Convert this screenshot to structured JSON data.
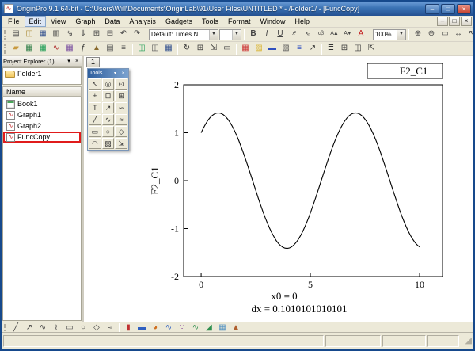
{
  "window": {
    "title": "OriginPro 9.1 64-bit - C:\\Users\\Will\\Documents\\OriginLab\\91\\User Files\\UNTITLED * - /Folder1/ - [FuncCopy]",
    "controls": {
      "minimize": "–",
      "maximize": "□",
      "close": "×"
    }
  },
  "menu": {
    "items": [
      "File",
      "Edit",
      "View",
      "Graph",
      "Data",
      "Analysis",
      "Gadgets",
      "Tools",
      "Format",
      "Window",
      "Help"
    ],
    "active": "Edit",
    "mdi_controls": [
      "–",
      "□",
      "×"
    ]
  },
  "toolbar_standard": {
    "left_icons": [
      {
        "name": "new-project-button",
        "glyph": "▤"
      },
      {
        "name": "open-button",
        "glyph": "◫",
        "color": "#a8862f"
      },
      {
        "name": "save-project-button",
        "glyph": "▦",
        "color": "#33518f"
      },
      {
        "name": "print-button",
        "glyph": "▥"
      },
      {
        "name": "import-wizard-button",
        "glyph": "⇘"
      },
      {
        "name": "import-ascii-button",
        "glyph": "⇓"
      },
      {
        "name": "copy-button",
        "glyph": "⊞"
      },
      {
        "name": "paste-button",
        "glyph": "⊟"
      },
      {
        "name": "undo-button",
        "glyph": "↶"
      },
      {
        "name": "redo-button",
        "glyph": "↷"
      }
    ],
    "font_combo": {
      "value": "Default: Times N"
    },
    "size_combo": {
      "value": ""
    },
    "format_icons": [
      {
        "name": "bold-button",
        "glyph": "B",
        "style": "bold"
      },
      {
        "name": "italic-button",
        "glyph": "I",
        "style": "italic"
      },
      {
        "name": "underline-button",
        "glyph": "U",
        "style": "underline"
      },
      {
        "name": "superscript-button",
        "glyph": "x²",
        "style": "small"
      },
      {
        "name": "subscript-button",
        "glyph": "x₂",
        "style": "small"
      },
      {
        "name": "greek-button",
        "glyph": "αβ",
        "style": "small"
      },
      {
        "name": "increase-font-button",
        "glyph": "A▲",
        "style": "small"
      },
      {
        "name": "decrease-font-button",
        "glyph": "A▼",
        "style": "small"
      },
      {
        "name": "font-color-button",
        "glyph": "A",
        "color": "#c22020"
      }
    ],
    "zoom_combo": {
      "value": "100%"
    },
    "right_icons": [
      {
        "name": "zoom-in-button",
        "glyph": "⊕"
      },
      {
        "name": "zoom-out-button",
        "glyph": "⊖"
      },
      {
        "name": "whole-page-button",
        "glyph": "▭"
      },
      {
        "name": "rescale-button",
        "glyph": "↔"
      },
      {
        "name": "pointer-button",
        "glyph": "↖"
      },
      {
        "name": "help-button",
        "glyph": "?"
      }
    ]
  },
  "toolbar_new": {
    "group1": [
      {
        "name": "new-folder-button",
        "glyph": "▰",
        "color": "#c89a3f"
      },
      {
        "name": "new-workbook-button",
        "glyph": "▦",
        "color": "#2e7d46"
      },
      {
        "name": "new-excel-button",
        "glyph": "▦",
        "color": "#1f9d55"
      },
      {
        "name": "new-graph-button",
        "glyph": "∿",
        "color": "#b03030"
      },
      {
        "name": "new-matrix-button",
        "glyph": "▦",
        "color": "#7a4fa0"
      },
      {
        "name": "new-function-button",
        "glyph": "ƒ",
        "color": "#333333"
      },
      {
        "name": "new-3d-graph-button",
        "glyph": "▲",
        "color": "#8a6b2f"
      },
      {
        "name": "new-layout-button",
        "glyph": "▤",
        "color": "#555555"
      },
      {
        "name": "new-notes-button",
        "glyph": "≡",
        "color": "#555555"
      }
    ],
    "group2": [
      {
        "name": "open-excel-button",
        "glyph": "◫",
        "color": "#1f9d55"
      },
      {
        "name": "open-template-button",
        "glyph": "◫",
        "color": "#555555"
      },
      {
        "name": "save-template-button",
        "glyph": "▦",
        "color": "#33518f"
      }
    ],
    "group3": [
      {
        "name": "refresh-button",
        "glyph": "↻",
        "color": "#333333"
      },
      {
        "name": "duplicate-window-button",
        "glyph": "⊞",
        "color": "#333333"
      },
      {
        "name": "rescale-layers-button",
        "glyph": "⇲",
        "color": "#333333"
      },
      {
        "name": "fit-page-button",
        "glyph": "▭",
        "color": "#333333"
      }
    ],
    "group4": [
      {
        "name": "color-palette-button",
        "glyph": "▦",
        "color": "#cc3333"
      },
      {
        "name": "fill-color-button",
        "glyph": "▨",
        "color": "#d8b12a"
      },
      {
        "name": "line-color-button",
        "glyph": "▬",
        "color": "#3050c0"
      },
      {
        "name": "pattern-button",
        "glyph": "▧",
        "color": "#555555"
      },
      {
        "name": "line-style-button",
        "glyph": "≡",
        "color": "#3050c0"
      },
      {
        "name": "arrow-style-button",
        "glyph": "↗",
        "color": "#333333"
      }
    ],
    "group5": [
      {
        "name": "layer-management-button",
        "glyph": "≣",
        "color": "#333333"
      },
      {
        "name": "add-layer-button",
        "glyph": "⊞",
        "color": "#333333"
      },
      {
        "name": "merge-graph-button",
        "glyph": "◫",
        "color": "#333333"
      },
      {
        "name": "extract-graph-button",
        "glyph": "⇱",
        "color": "#333333"
      }
    ]
  },
  "toolbar_plot": {
    "draw_icons": [
      {
        "name": "line-tool",
        "glyph": "╱",
        "color": "#444444"
      },
      {
        "name": "arrow-tool",
        "glyph": "↗",
        "color": "#444444"
      },
      {
        "name": "curve-tool",
        "glyph": "∿",
        "color": "#444444"
      },
      {
        "name": "polyline-tool",
        "glyph": "≀",
        "color": "#444444"
      },
      {
        "name": "rectangle-tool",
        "glyph": "▭",
        "color": "#444444"
      },
      {
        "name": "circle-tool",
        "glyph": "○",
        "color": "#444444"
      },
      {
        "name": "polygon-tool",
        "glyph": "◇",
        "color": "#444444"
      },
      {
        "name": "freehand-tool",
        "glyph": "≈",
        "color": "#444444"
      }
    ],
    "plot_icons": [
      {
        "name": "column-plot-button",
        "glyph": "▮",
        "color": "#c03030"
      },
      {
        "name": "bar-plot-button",
        "glyph": "▬",
        "color": "#3060c0"
      },
      {
        "name": "pie-plot-button",
        "glyph": "◕",
        "color": "#d07020"
      },
      {
        "name": "line-plot-button",
        "glyph": "∿",
        "color": "#3060c0"
      },
      {
        "name": "scatter-plot-button",
        "glyph": "∵",
        "color": "#7a2f8f"
      },
      {
        "name": "line-symbol-plot-button",
        "glyph": "∿",
        "color": "#2f8f4f"
      },
      {
        "name": "area-plot-button",
        "glyph": "◢",
        "color": "#2f8f4f"
      },
      {
        "name": "contour-plot-button",
        "glyph": "▦",
        "color": "#5090c0"
      },
      {
        "name": "surface-3d-plot-button",
        "glyph": "▲",
        "color": "#b06030"
      }
    ]
  },
  "project_explorer": {
    "title": "Project Explorer (1)",
    "collapse_icon": "▾",
    "close_icon": "×",
    "folders": [
      {
        "label": "Folder1"
      }
    ],
    "column_header": "Name",
    "items": [
      {
        "label": "Book1",
        "type": "workbook",
        "highlighted": false
      },
      {
        "label": "Graph1",
        "type": "graph",
        "highlighted": false
      },
      {
        "label": "Graph2",
        "type": "graph",
        "highlighted": false
      },
      {
        "label": "FuncCopy",
        "type": "graph",
        "highlighted": true
      }
    ]
  },
  "tools_palette": {
    "title": "Tools",
    "collapse_icon": "▾",
    "close_icon": "×",
    "tools": [
      {
        "name": "pointer-tool",
        "glyph": "↖"
      },
      {
        "name": "zoom-in-tool",
        "glyph": "◎"
      },
      {
        "name": "screen-reader-tool",
        "glyph": "⊙"
      },
      {
        "name": "data-reader-tool",
        "glyph": "+"
      },
      {
        "name": "data-selector-tool",
        "glyph": "⊡"
      },
      {
        "name": "mask-tool",
        "glyph": "⊞"
      },
      {
        "name": "text-tool",
        "glyph": "T"
      },
      {
        "name": "arrow-tool",
        "glyph": "↗"
      },
      {
        "name": "curved-arrow-tool",
        "glyph": "∽"
      },
      {
        "name": "line-tool",
        "glyph": "╱"
      },
      {
        "name": "polyline-tool",
        "glyph": "∿"
      },
      {
        "name": "freehand-tool",
        "glyph": "≈"
      },
      {
        "name": "rectangle-tool",
        "glyph": "▭"
      },
      {
        "name": "circle-tool",
        "glyph": "○"
      },
      {
        "name": "polygon-tool",
        "glyph": "◇"
      },
      {
        "name": "region-tool",
        "glyph": "◠"
      },
      {
        "name": "fill-area-tool",
        "glyph": "▨"
      },
      {
        "name": "rescale-tool",
        "glyph": "⇲"
      }
    ]
  },
  "graph_window": {
    "layer_button": "1"
  },
  "chart_data": {
    "type": "line",
    "title": "",
    "xlabel": "",
    "ylabel": "F2_C1",
    "legend": "F2_C1",
    "legend_position": "top-right",
    "grid": false,
    "xlim": [
      -0.8,
      11.05
    ],
    "ylim": [
      -2,
      2
    ],
    "x_ticks": [
      0,
      5,
      10
    ],
    "y_ticks": [
      2,
      1,
      0,
      -1,
      -2
    ],
    "x0": 0,
    "dx": 0.1010101010101,
    "n_points": 100,
    "function": {
      "description": "sin(x)+cos(x)",
      "amplitude": 1.4142,
      "omega": 1,
      "phase": 0.7854
    },
    "annotations": [
      "x0 = 0",
      "dx = 0.1010101010101"
    ]
  }
}
